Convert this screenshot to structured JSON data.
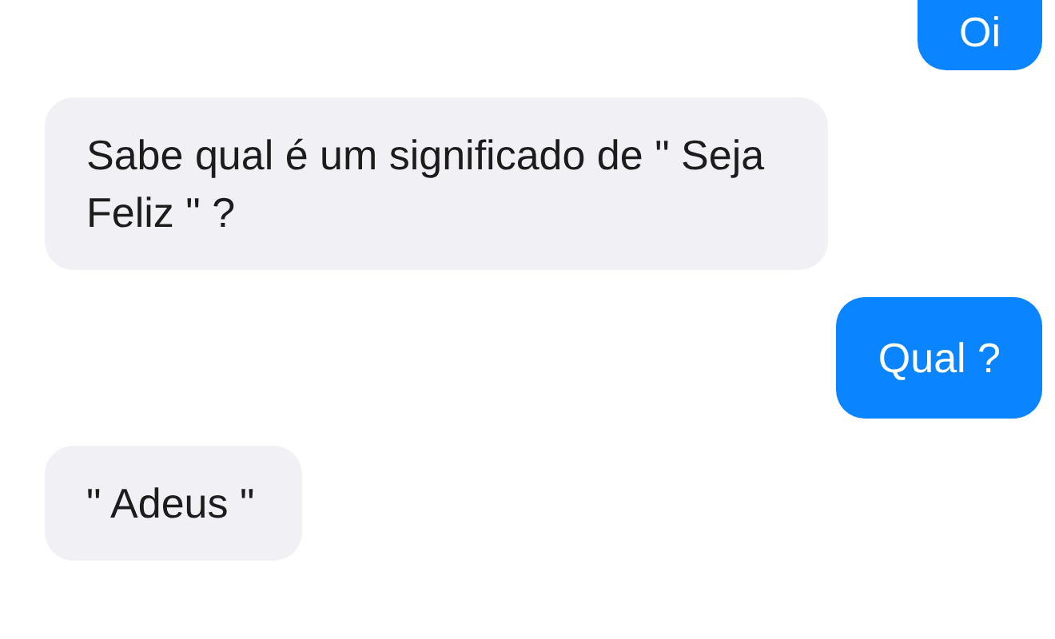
{
  "messages": [
    {
      "kind": "sent",
      "text": "Oi"
    },
    {
      "kind": "received",
      "text": "Sabe qual é um significado de \" Seja Feliz \" ?"
    },
    {
      "kind": "sent",
      "text": "Qual ?"
    },
    {
      "kind": "received",
      "text": "\" Adeus \""
    }
  ]
}
